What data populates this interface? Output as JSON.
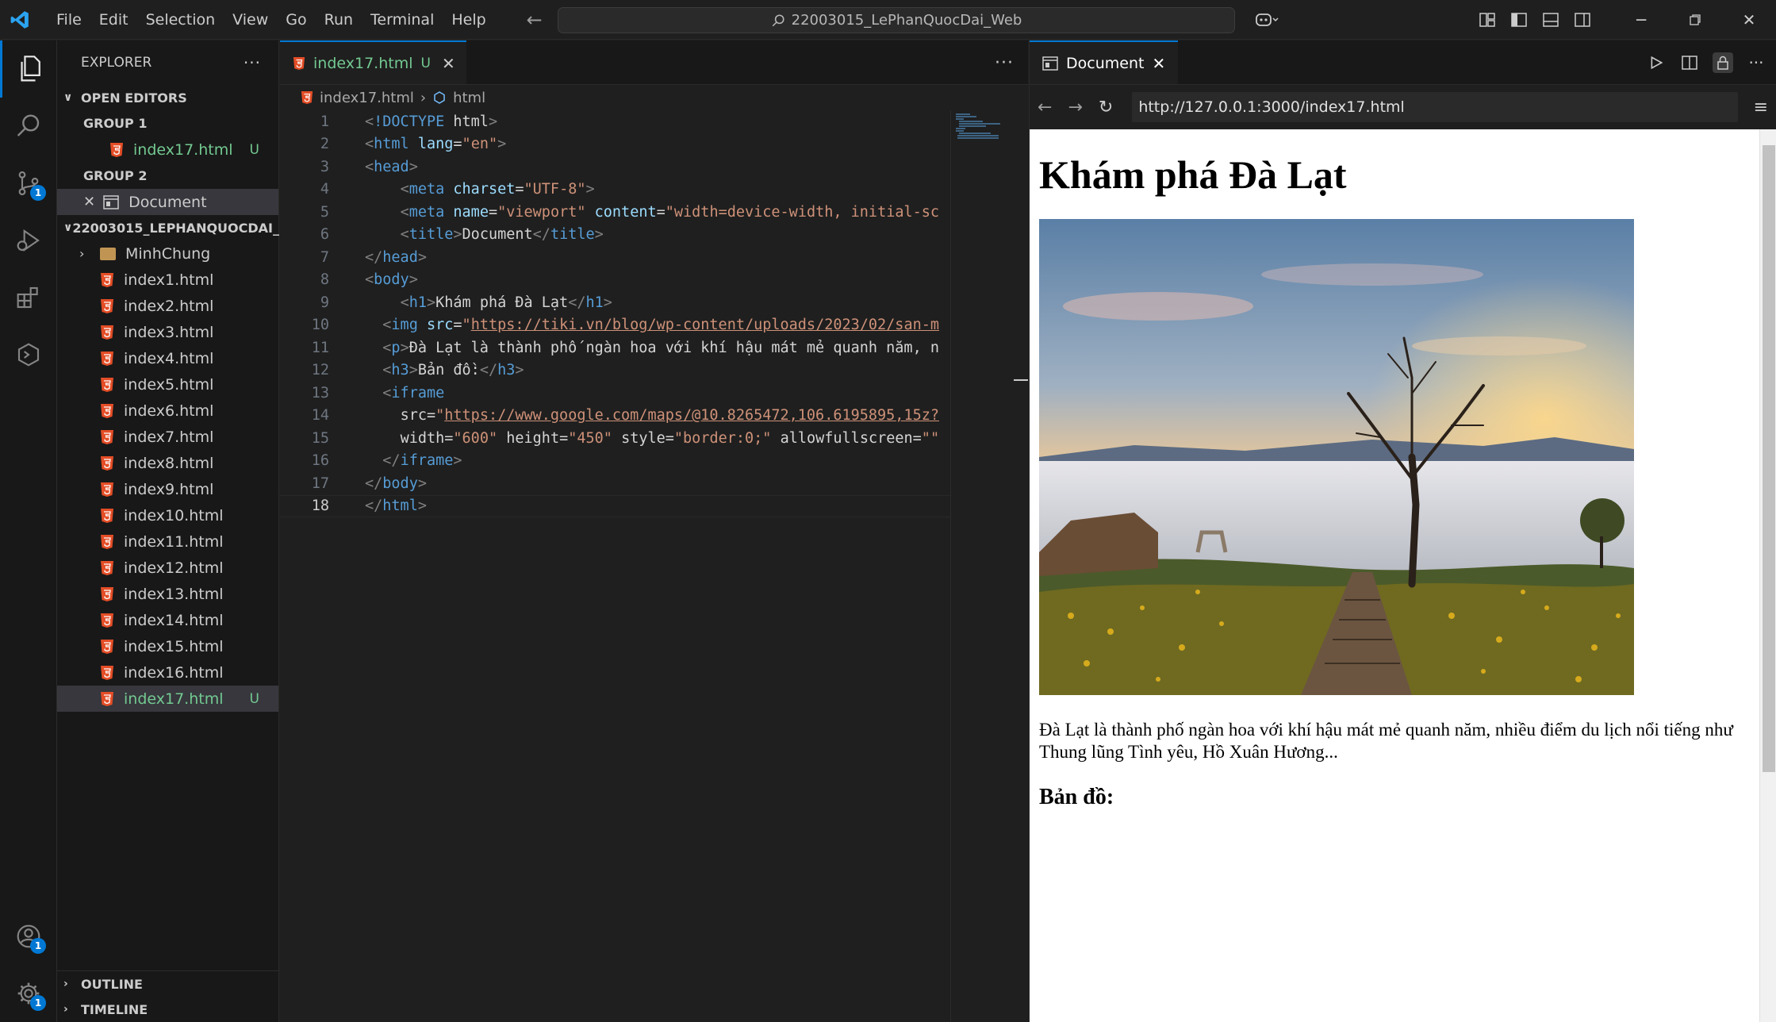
{
  "titlebar": {
    "menu": [
      "File",
      "Edit",
      "Selection",
      "View",
      "Go",
      "Run",
      "Terminal",
      "Help"
    ],
    "search": "22003015_LePhanQuocDai_Web"
  },
  "activity_badges": {
    "scm": "1",
    "accounts": "1",
    "settings": "1"
  },
  "explorer": {
    "title": "EXPLORER",
    "open_editors": "OPEN EDITORS",
    "group1": "GROUP 1",
    "group1_file": "index17.html",
    "group1_flag": "U",
    "group2": "GROUP 2",
    "group2_item": "Document",
    "workspace": "22003015_LEPHANQUOCDAI_...",
    "folder": "MinhChung",
    "files": [
      "index1.html",
      "index2.html",
      "index3.html",
      "index4.html",
      "index5.html",
      "index6.html",
      "index7.html",
      "index8.html",
      "index9.html",
      "index10.html",
      "index11.html",
      "index12.html",
      "index13.html",
      "index14.html",
      "index15.html",
      "index16.html"
    ],
    "active_file": "index17.html",
    "active_flag": "U",
    "outline": "OUTLINE",
    "timeline": "TIMELINE"
  },
  "editor": {
    "tab_label": "index17.html",
    "tab_flag": "U",
    "breadcrumb_file": "index17.html",
    "breadcrumb_node": "html",
    "current_line": 18,
    "lines": [
      "<!DOCTYPE html>",
      "<html lang=\"en\">",
      "<head>",
      "    <meta charset=\"UTF-8\">",
      "    <meta name=\"viewport\" content=\"width=device-width, initial-sc",
      "    <title>Document</title>",
      "</head>",
      "<body>",
      "    <h1>Khám phá Đà Lạt</h1>",
      "  <img src=\"https://tiki.vn/blog/wp-content/uploads/2023/02/san-m",
      "  <p>Đà Lạt là thành phố ngàn hoa với khí hậu mát mẻ quanh năm, n",
      "  <h3>Bản đồ:</h3>",
      "  <iframe",
      "    src=\"https://www.google.com/maps/@10.8265472,106.6195895,15z?",
      "    width=\"600\" height=\"450\" style=\"border:0;\" allowfullscreen=\"\"",
      "  </iframe>",
      "</body>",
      "</html>"
    ]
  },
  "browser": {
    "tab_label": "Document",
    "url": "http://127.0.0.1:3000/index17.html",
    "page": {
      "h1": "Khám phá Đà Lạt",
      "paragraph": "Đà Lạt là thành phố ngàn hoa với khí hậu mát mẻ quanh năm, nhiều điểm du lịch nổi tiếng như Thung lũng Tình yêu, Hồ Xuân Hương...",
      "h3": "Bản đồ:"
    }
  },
  "colors": {
    "accent": "#0078d4",
    "untracked": "#73c991",
    "html_icon": "#e44d26"
  }
}
